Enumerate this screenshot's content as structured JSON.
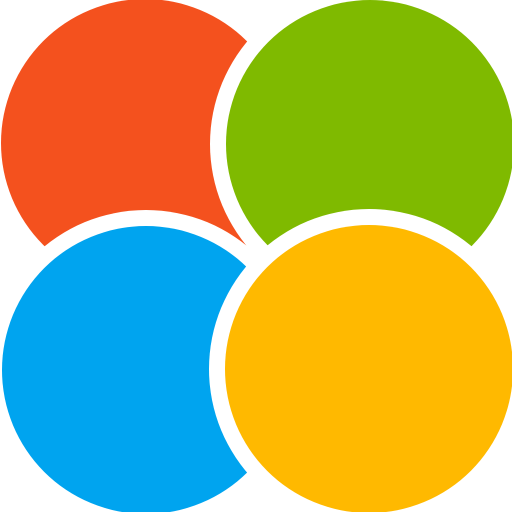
{
  "logo": {
    "name": "four-circle-logo",
    "colors": {
      "orange": "#F4511E",
      "green": "#7FBA00",
      "blue": "#00A4EF",
      "yellow": "#FFB900",
      "background": "#FFFFFF"
    },
    "shapes": [
      {
        "name": "orange-circle",
        "color_key": "orange"
      },
      {
        "name": "green-circle",
        "color_key": "green"
      },
      {
        "name": "blue-circle",
        "color_key": "blue"
      },
      {
        "name": "yellow-circle",
        "color_key": "yellow"
      }
    ]
  }
}
